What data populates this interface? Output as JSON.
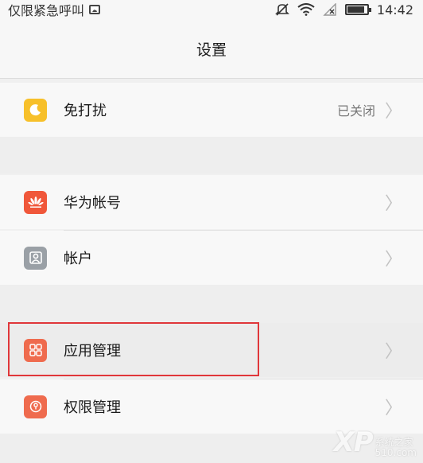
{
  "status_bar": {
    "carrier": "仅限紧急呼叫",
    "time": "14:42",
    "icons": [
      "image-icon",
      "mute-icon",
      "wifi-icon",
      "no-signal-icon",
      "battery-icon"
    ]
  },
  "header": {
    "title": "设置"
  },
  "settings": {
    "dnd": {
      "label": "免打扰",
      "value": "已关闭",
      "icon": "moon-icon",
      "color": "#f7c02a"
    },
    "huawei_account": {
      "label": "华为帐号",
      "icon": "huawei-logo-icon",
      "color": "#f0573a"
    },
    "accounts": {
      "label": "帐户",
      "icon": "person-icon",
      "color": "#9aa0a6"
    },
    "app_manager": {
      "label": "应用管理",
      "icon": "apps-grid-icon",
      "color": "#ef6b4e"
    },
    "permission_manager": {
      "label": "权限管理",
      "icon": "permission-icon",
      "color": "#ef6b4e"
    }
  },
  "highlight_color": "#e0373a",
  "watermark": {
    "logo": "XP",
    "line1": "系统之家",
    "line2": "510.com"
  }
}
